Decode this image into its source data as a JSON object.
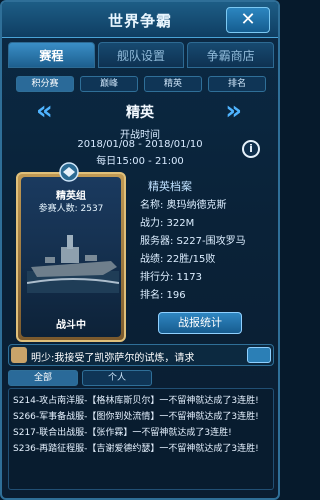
{
  "header": {
    "title": "世界争霸",
    "close": "✕"
  },
  "tabs": [
    {
      "label": "赛程",
      "active": true
    },
    {
      "label": "舰队设置",
      "active": false
    },
    {
      "label": "争霸商店",
      "active": false
    }
  ],
  "subtabs": [
    {
      "label": "积分赛",
      "active": true
    },
    {
      "label": "巅峰",
      "active": false
    },
    {
      "label": "精英",
      "active": false
    },
    {
      "label": "排名",
      "active": false
    }
  ],
  "season": {
    "name": "精英",
    "open_label": "开战时间",
    "dates": "2018/01/08 - 2018/01/10",
    "daily": "每日15:00 - 21:00",
    "prev_icon": "«",
    "next_icon": "»",
    "info_icon": "i"
  },
  "card": {
    "tier": "精英组",
    "participants": "参赛人数: 2537",
    "status": "战斗中"
  },
  "profile": {
    "title": "精英档案",
    "rows": [
      "名称: 奥玛纳德克斯",
      "战力: 322M",
      "服务器: S227-围攻罗马",
      "战绩: 22胜/15败",
      "排行分: 1173",
      "排名: 196"
    ],
    "stats_button": "战报统计"
  },
  "chat": {
    "message": "明少:我接受了凯弥萨尔的试炼，请求"
  },
  "log_tabs": [
    {
      "label": "全部",
      "active": true
    },
    {
      "label": "个人",
      "active": false
    }
  ],
  "log": [
    "S214-攻占南洋服-【格林库斯贝尔】一不留神就达成了3连胜!",
    "S266-军事备战服-【图你到处流情】一不留神就达成了3连胜!",
    "S217-联合出战服-【张作霖】一不留神就达成了3连胜!",
    "S236-再踏征程服-【吉谢爱德约瑟】一不留神就达成了3连胜!"
  ],
  "colors": {
    "accent": "#4fb4ff",
    "gold": "#e0c07a"
  }
}
